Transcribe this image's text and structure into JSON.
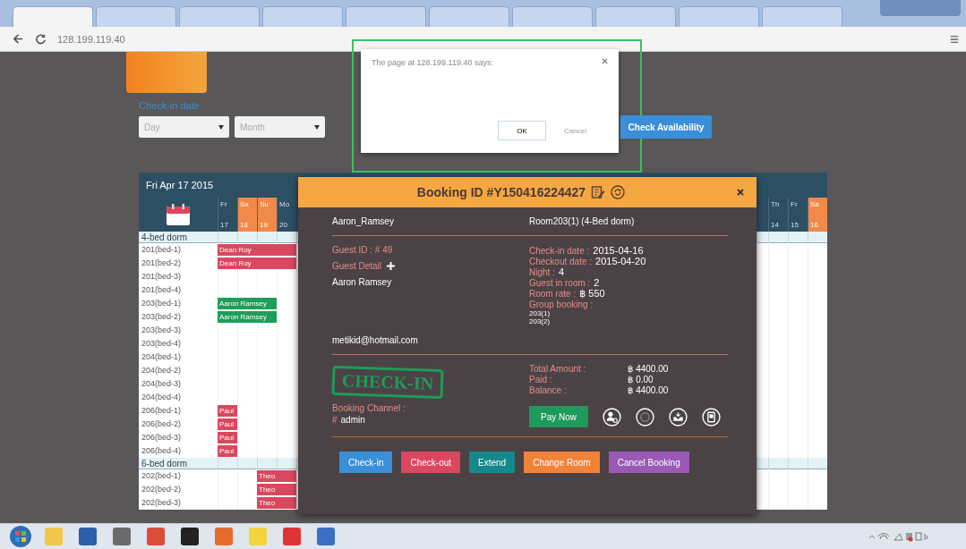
{
  "browser": {
    "tabs": [
      {
        "selected": true
      },
      {
        "selected": false
      },
      {
        "selected": false
      },
      {
        "selected": false
      },
      {
        "selected": false
      },
      {
        "selected": false
      },
      {
        "selected": false
      },
      {
        "selected": false
      },
      {
        "selected": false
      },
      {
        "selected": false
      }
    ],
    "address": "128.199.119.40"
  },
  "search_form": {
    "label": "Check-in date",
    "day_placeholder": "Day",
    "month_placeholder": "Month",
    "button": "Check Availability"
  },
  "alert": {
    "title": "The page at 128.199.119.40 says:",
    "ok": "OK",
    "cancel": "Cancel"
  },
  "schedule": {
    "title": "Fri Apr 17 2015",
    "days_left": [
      {
        "name": "Fr",
        "date": "17",
        "weekend": false
      },
      {
        "name": "Sa",
        "date": "18",
        "weekend": true
      },
      {
        "name": "Su",
        "date": "19",
        "weekend": true
      },
      {
        "name": "Mo",
        "date": "20",
        "weekend": false
      }
    ],
    "days_right": [
      {
        "name": "Th",
        "date": "14",
        "weekend": false
      },
      {
        "name": "Fr",
        "date": "15",
        "weekend": false
      },
      {
        "name": "Sa",
        "date": "16",
        "weekend": true
      }
    ],
    "groups": [
      {
        "name": "4-bed dorm",
        "rows": [
          {
            "bed": "201(bed-1)",
            "cells": [
              {
                "booked": true,
                "guest": "Dean Roy",
                "color": "#d9485f"
              },
              {
                "booked": true,
                "color": "#d9485f"
              },
              {
                "booked": true,
                "color": "#d9485f"
              },
              {
                "booked": true,
                "color": "#d9485f"
              }
            ]
          },
          {
            "bed": "201(bed-2)",
            "cells": [
              {
                "booked": true,
                "guest": "Dean Roy",
                "color": "#d9485f"
              },
              {
                "booked": true,
                "color": "#d9485f"
              },
              {
                "booked": true,
                "color": "#d9485f"
              },
              {
                "booked": true,
                "color": "#d9485f"
              }
            ]
          },
          {
            "bed": "201(bed-3)",
            "cells": [
              {
                "booked": false
              },
              {
                "booked": false
              },
              {
                "booked": false
              },
              {
                "booked": false
              }
            ]
          },
          {
            "bed": "201(bed-4)",
            "cells": [
              {
                "booked": false
              },
              {
                "booked": false
              },
              {
                "booked": false
              },
              {
                "booked": false
              }
            ]
          },
          {
            "bed": "203(bed-1)",
            "cells": [
              {
                "booked": true,
                "guest": "Aaron Ramsey",
                "color": "#1e9e5a"
              },
              {
                "booked": true,
                "color": "#1e9e5a"
              },
              {
                "booked": true,
                "color": "#1e9e5a"
              },
              {
                "booked": false
              }
            ]
          },
          {
            "bed": "203(bed-2)",
            "cells": [
              {
                "booked": true,
                "guest": "Aaron Ramsey",
                "color": "#1e9e5a"
              },
              {
                "booked": true,
                "color": "#1e9e5a"
              },
              {
                "booked": true,
                "color": "#1e9e5a"
              },
              {
                "booked": false
              }
            ]
          },
          {
            "bed": "203(bed-3)",
            "cells": [
              {
                "booked": false
              },
              {
                "booked": false
              },
              {
                "booked": false
              },
              {
                "booked": false
              }
            ]
          },
          {
            "bed": "203(bed-4)",
            "cells": [
              {
                "booked": false
              },
              {
                "booked": false
              },
              {
                "booked": false
              },
              {
                "booked": false
              }
            ]
          },
          {
            "bed": "204(bed-1)",
            "cells": [
              {
                "booked": false
              },
              {
                "booked": false
              },
              {
                "booked": false
              },
              {
                "booked": false
              }
            ]
          },
          {
            "bed": "204(bed-2)",
            "cells": [
              {
                "booked": false
              },
              {
                "booked": false
              },
              {
                "booked": false
              },
              {
                "booked": false
              }
            ]
          },
          {
            "bed": "204(bed-3)",
            "cells": [
              {
                "booked": false
              },
              {
                "booked": false
              },
              {
                "booked": false
              },
              {
                "booked": false
              }
            ]
          },
          {
            "bed": "204(bed-4)",
            "cells": [
              {
                "booked": false
              },
              {
                "booked": false
              },
              {
                "booked": false
              },
              {
                "booked": false
              }
            ]
          },
          {
            "bed": "206(bed-1)",
            "cells": [
              {
                "booked": true,
                "guest": "Paul",
                "color": "#d9485f"
              },
              {
                "booked": false
              },
              {
                "booked": false
              },
              {
                "booked": false
              }
            ]
          },
          {
            "bed": "206(bed-2)",
            "cells": [
              {
                "booked": true,
                "guest": "Paul",
                "color": "#d9485f"
              },
              {
                "booked": false
              },
              {
                "booked": false
              },
              {
                "booked": false
              }
            ]
          },
          {
            "bed": "206(bed-3)",
            "cells": [
              {
                "booked": true,
                "guest": "Paul",
                "color": "#d9485f"
              },
              {
                "booked": false
              },
              {
                "booked": false
              },
              {
                "booked": false
              }
            ]
          },
          {
            "bed": "206(bed-4)",
            "cells": [
              {
                "booked": true,
                "guest": "Paul",
                "color": "#d9485f"
              },
              {
                "booked": false
              },
              {
                "booked": false
              },
              {
                "booked": false
              }
            ]
          }
        ]
      },
      {
        "name": "6-bed dorm",
        "rows": [
          {
            "bed": "202(bed-1)",
            "cells": [
              {
                "booked": false
              },
              {
                "booked": false
              },
              {
                "booked": true,
                "guest": "Theo",
                "color": "#d9485f"
              },
              {
                "booked": true,
                "color": "#d9485f"
              }
            ]
          },
          {
            "bed": "202(bed-2)",
            "cells": [
              {
                "booked": false
              },
              {
                "booked": false
              },
              {
                "booked": true,
                "guest": "Theo",
                "color": "#d9485f"
              },
              {
                "booked": true,
                "color": "#d9485f"
              }
            ]
          },
          {
            "bed": "202(bed-3)",
            "cells": [
              {
                "booked": false
              },
              {
                "booked": false
              },
              {
                "booked": true,
                "guest": "Theo",
                "color": "#d9485f"
              },
              {
                "booked": true,
                "color": "#d9485f"
              }
            ]
          }
        ]
      }
    ]
  },
  "booking": {
    "title": "Booking ID #Y150416224427",
    "guest_name": "Aaron_Ramsey",
    "room": "Room203(1) (4-Bed dorm)",
    "guest_id": "Guest ID : # 49",
    "guest_detail_label": "Guest Detail",
    "guest_full_name": "Aaron Ramsey",
    "email": "metikid@hotmail.com",
    "details": [
      {
        "label": "Check-in date :",
        "value": "2015-04-16"
      },
      {
        "label": "Checkout date :",
        "value": "2015-04-20"
      },
      {
        "label": "Night :",
        "value": "4"
      },
      {
        "label": "Guest in room :",
        "value": "2"
      },
      {
        "label": "Room rate :",
        "value": "฿ 550"
      }
    ],
    "group_label": "Group booking :",
    "group_rooms": [
      "203(1)",
      "203(2)"
    ],
    "status_stamp": "CHECK-IN",
    "channel_label": "Booking Channel :",
    "channel_mark": "#",
    "channel": "admin",
    "amounts": [
      {
        "label": "Total Amount :",
        "value": "฿ 4400.00"
      },
      {
        "label": "Paid :",
        "value": "฿ 0.00"
      },
      {
        "label": "Balance :",
        "value": "฿ 4400.00"
      }
    ],
    "pay_button": "Pay Now",
    "actions": [
      {
        "label": "Check-in",
        "color": "#3a8fd6"
      },
      {
        "label": "Check-out",
        "color": "#d9485f"
      },
      {
        "label": "Extend",
        "color": "#16878a"
      },
      {
        "label": "Change Room",
        "color": "#f0823a"
      },
      {
        "label": "Cancel Booking",
        "color": "#9b59b6"
      }
    ]
  }
}
